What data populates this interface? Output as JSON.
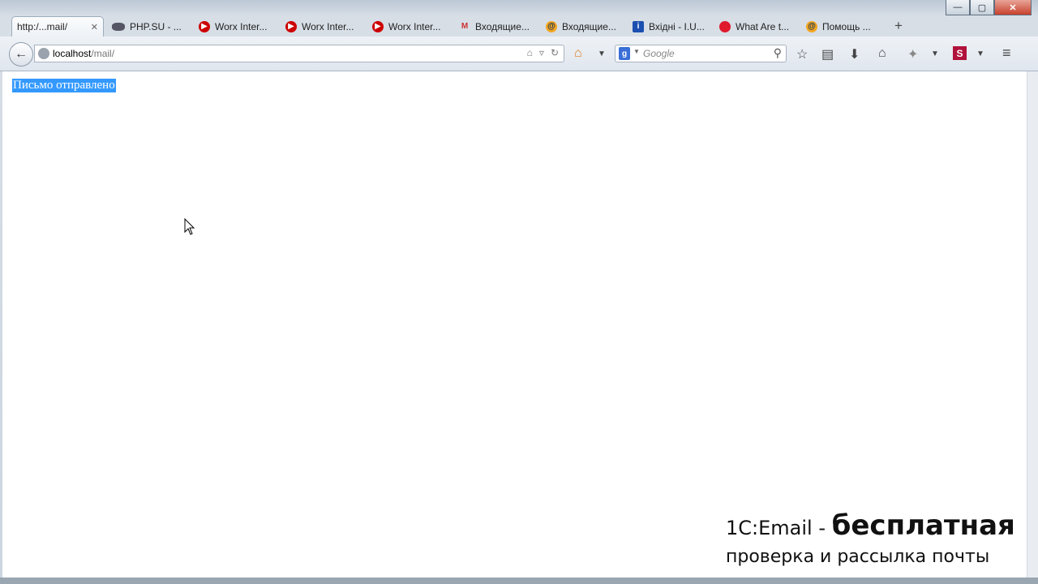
{
  "window": {
    "controls": {
      "minimize": "—",
      "maximize": "▢",
      "close": "✕"
    }
  },
  "tabs": [
    {
      "label": "http:/...mail/",
      "icon": "none",
      "active": true,
      "close": "✕"
    },
    {
      "label": "PHP.SU - ...",
      "icon": "phpsu-icon"
    },
    {
      "label": "Worx Inter...",
      "icon": "worx-icon"
    },
    {
      "label": "Worx Inter...",
      "icon": "worx-icon"
    },
    {
      "label": "Worx Inter...",
      "icon": "worx-icon"
    },
    {
      "label": "Входящие...",
      "icon": "gmail-icon"
    },
    {
      "label": "Входящие...",
      "icon": "mailru-icon"
    },
    {
      "label": "Вхідні - I.U...",
      "icon": "info-icon"
    },
    {
      "label": "What Are t...",
      "icon": "red-dot-icon"
    },
    {
      "label": "Помощь ...",
      "icon": "mailru-icon"
    }
  ],
  "new_tab": "+",
  "urlbar": {
    "host": "localhost",
    "path": "/mail/"
  },
  "search": {
    "placeholder": "Google",
    "engine": "g-icon"
  },
  "page": {
    "message": "Письмо отправлено"
  },
  "promo": {
    "line1_prefix": "1C:Email - ",
    "line1_big": "бесплатная",
    "line2": "проверка и рассылка почты"
  }
}
